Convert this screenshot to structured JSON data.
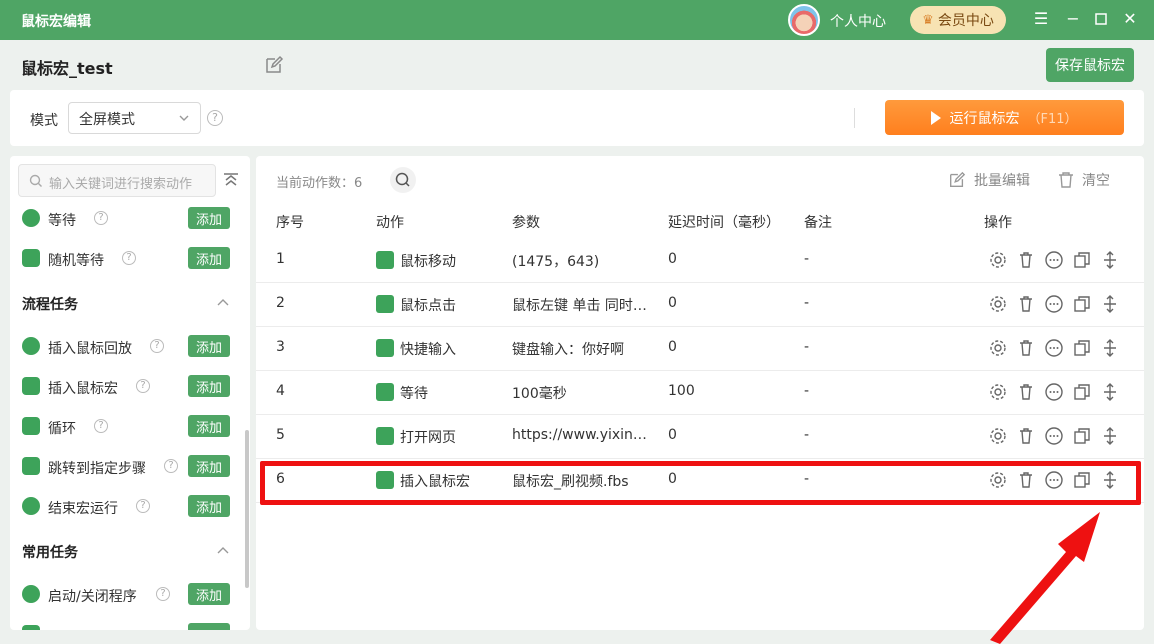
{
  "app": {
    "title": "鼠标宏编辑",
    "personal_center": "个人中心",
    "member_center": "会员中心"
  },
  "header": {
    "macro_name": "鼠标宏_test",
    "save_label": "保存鼠标宏"
  },
  "mode": {
    "label": "模式",
    "selected": "全屏模式",
    "run_label": "运行鼠标宏",
    "run_hotkey": "（F11）"
  },
  "sidebar": {
    "search_placeholder": "输入关键词进行搜索动作",
    "add_label": "添加",
    "items_top": [
      {
        "label": "等待"
      },
      {
        "label": "随机等待"
      }
    ],
    "section_flow": "流程任务",
    "items_flow": [
      {
        "label": "插入鼠标回放"
      },
      {
        "label": "插入鼠标宏"
      },
      {
        "label": "循环"
      },
      {
        "label": "跳转到指定步骤"
      },
      {
        "label": "结束宏运行"
      }
    ],
    "section_common": "常用任务",
    "items_common": [
      {
        "label": "启动/关闭程序"
      }
    ]
  },
  "main": {
    "count_label": "当前动作数：6",
    "batch_edit": "批量编辑",
    "clear": "清空",
    "columns": [
      "序号",
      "动作",
      "参数",
      "延迟时间（毫秒）",
      "备注",
      "操作"
    ],
    "rows": [
      {
        "no": "1",
        "action": "鼠标移动",
        "param": "(1475，643)",
        "delay": "0",
        "note": "-"
      },
      {
        "no": "2",
        "action": "鼠标点击",
        "param": "鼠标左键 单击 同时…",
        "delay": "0",
        "note": "-"
      },
      {
        "no": "3",
        "action": "快捷输入",
        "param": "键盘输入：你好啊",
        "delay": "0",
        "note": "-"
      },
      {
        "no": "4",
        "action": "等待",
        "param": "100毫秒",
        "delay": "100",
        "note": "-"
      },
      {
        "no": "5",
        "action": "打开网页",
        "param": "https://www.yixin…",
        "delay": "0",
        "note": "-"
      },
      {
        "no": "6",
        "action": "插入鼠标宏",
        "param": "鼠标宏_刷视频.fbs",
        "delay": "0",
        "note": "-"
      }
    ]
  },
  "colors": {
    "brand_green": "#4fa565",
    "run_orange": "#ff8a2a",
    "highlight_red": "#ee1111"
  }
}
